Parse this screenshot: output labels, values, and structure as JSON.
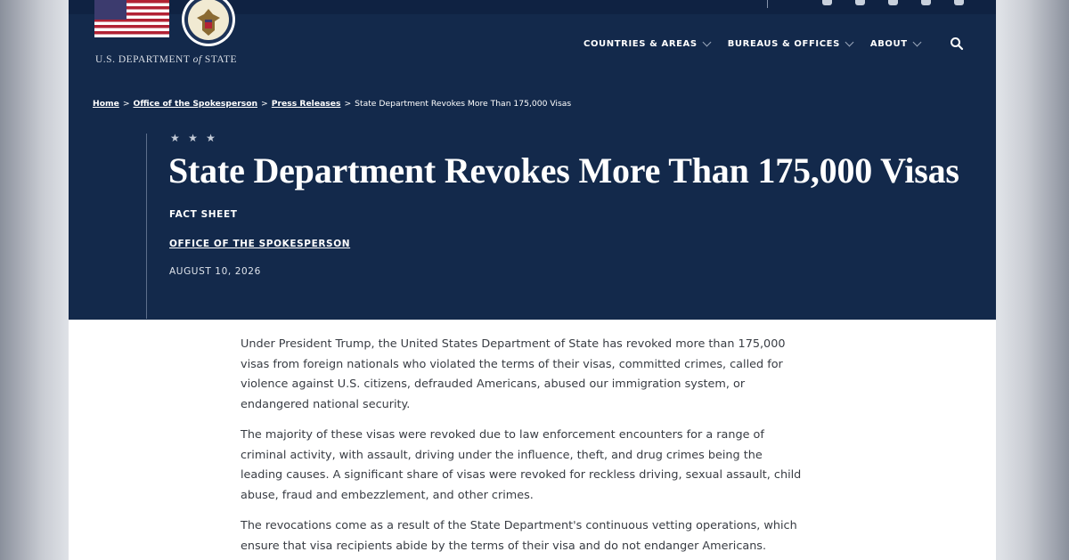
{
  "site": {
    "agency_name_pre": "U.S. DEPARTMENT",
    "agency_name_of": "of",
    "agency_name_post": "STATE"
  },
  "nav": {
    "items": [
      {
        "label": "COUNTRIES & AREAS"
      },
      {
        "label": "BUREAUS & OFFICES"
      },
      {
        "label": "ABOUT"
      }
    ]
  },
  "breadcrumb": {
    "home": "Home",
    "office": "Office of the Spokesperson",
    "press": "Press Releases",
    "current": "State Department Revokes More Than 175,000 Visas",
    "separator": ">"
  },
  "article": {
    "stars": "★ ★ ★",
    "title": "State Department Revokes More Than 175,000 Visas",
    "type": "FACT SHEET",
    "office": "OFFICE OF THE SPOKESPERSON",
    "date": "AUGUST 10, 2026",
    "paragraphs": [
      "Under President Trump, the United States Department of State has revoked more than 175,000 visas from foreign nationals who violated the terms of their visas, committed crimes, called for violence against U.S. citizens, defrauded Americans, abused our immigration system, or endangered national security.",
      "The majority of these visas were revoked due to law enforcement encounters for a range of criminal activity, with assault, driving under the influence, theft, and drug crimes being the leading causes. A significant share of visas were revoked for reckless driving, sexual assault, child abuse, fraud and embezzlement, and other crimes.",
      "The revocations come as a result of the State Department's continuous vetting operations, which ensure that visa recipients abide by the terms of their visa and do not endanger Americans."
    ]
  },
  "colors": {
    "hero_bg": "#13294b",
    "page_bg": "#ffffff",
    "body_text": "#383c43"
  }
}
